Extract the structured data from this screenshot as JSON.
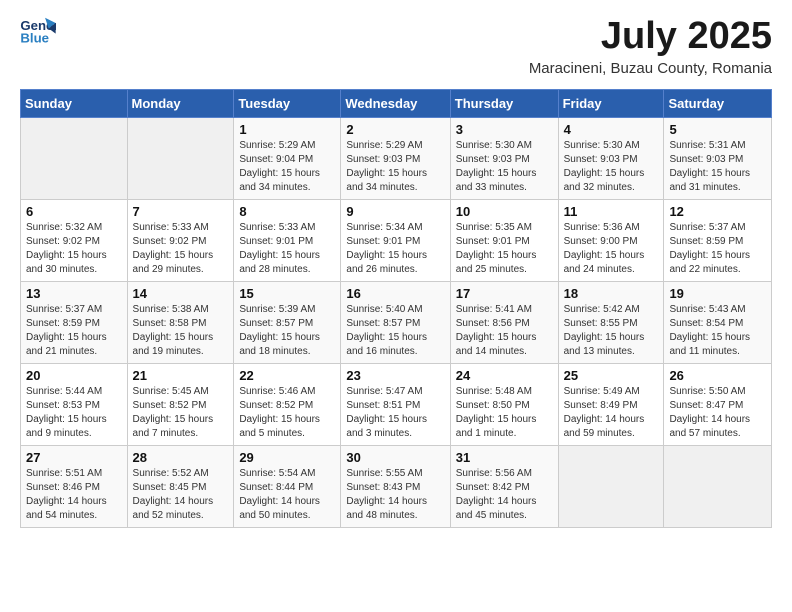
{
  "logo": {
    "line1": "General",
    "line2": "Blue"
  },
  "title": "July 2025",
  "location": "Maracineni, Buzau County, Romania",
  "weekdays": [
    "Sunday",
    "Monday",
    "Tuesday",
    "Wednesday",
    "Thursday",
    "Friday",
    "Saturday"
  ],
  "weeks": [
    [
      {
        "day": "",
        "detail": ""
      },
      {
        "day": "",
        "detail": ""
      },
      {
        "day": "1",
        "detail": "Sunrise: 5:29 AM\nSunset: 9:04 PM\nDaylight: 15 hours and 34 minutes."
      },
      {
        "day": "2",
        "detail": "Sunrise: 5:29 AM\nSunset: 9:03 PM\nDaylight: 15 hours and 34 minutes."
      },
      {
        "day": "3",
        "detail": "Sunrise: 5:30 AM\nSunset: 9:03 PM\nDaylight: 15 hours and 33 minutes."
      },
      {
        "day": "4",
        "detail": "Sunrise: 5:30 AM\nSunset: 9:03 PM\nDaylight: 15 hours and 32 minutes."
      },
      {
        "day": "5",
        "detail": "Sunrise: 5:31 AM\nSunset: 9:03 PM\nDaylight: 15 hours and 31 minutes."
      }
    ],
    [
      {
        "day": "6",
        "detail": "Sunrise: 5:32 AM\nSunset: 9:02 PM\nDaylight: 15 hours and 30 minutes."
      },
      {
        "day": "7",
        "detail": "Sunrise: 5:33 AM\nSunset: 9:02 PM\nDaylight: 15 hours and 29 minutes."
      },
      {
        "day": "8",
        "detail": "Sunrise: 5:33 AM\nSunset: 9:01 PM\nDaylight: 15 hours and 28 minutes."
      },
      {
        "day": "9",
        "detail": "Sunrise: 5:34 AM\nSunset: 9:01 PM\nDaylight: 15 hours and 26 minutes."
      },
      {
        "day": "10",
        "detail": "Sunrise: 5:35 AM\nSunset: 9:01 PM\nDaylight: 15 hours and 25 minutes."
      },
      {
        "day": "11",
        "detail": "Sunrise: 5:36 AM\nSunset: 9:00 PM\nDaylight: 15 hours and 24 minutes."
      },
      {
        "day": "12",
        "detail": "Sunrise: 5:37 AM\nSunset: 8:59 PM\nDaylight: 15 hours and 22 minutes."
      }
    ],
    [
      {
        "day": "13",
        "detail": "Sunrise: 5:37 AM\nSunset: 8:59 PM\nDaylight: 15 hours and 21 minutes."
      },
      {
        "day": "14",
        "detail": "Sunrise: 5:38 AM\nSunset: 8:58 PM\nDaylight: 15 hours and 19 minutes."
      },
      {
        "day": "15",
        "detail": "Sunrise: 5:39 AM\nSunset: 8:57 PM\nDaylight: 15 hours and 18 minutes."
      },
      {
        "day": "16",
        "detail": "Sunrise: 5:40 AM\nSunset: 8:57 PM\nDaylight: 15 hours and 16 minutes."
      },
      {
        "day": "17",
        "detail": "Sunrise: 5:41 AM\nSunset: 8:56 PM\nDaylight: 15 hours and 14 minutes."
      },
      {
        "day": "18",
        "detail": "Sunrise: 5:42 AM\nSunset: 8:55 PM\nDaylight: 15 hours and 13 minutes."
      },
      {
        "day": "19",
        "detail": "Sunrise: 5:43 AM\nSunset: 8:54 PM\nDaylight: 15 hours and 11 minutes."
      }
    ],
    [
      {
        "day": "20",
        "detail": "Sunrise: 5:44 AM\nSunset: 8:53 PM\nDaylight: 15 hours and 9 minutes."
      },
      {
        "day": "21",
        "detail": "Sunrise: 5:45 AM\nSunset: 8:52 PM\nDaylight: 15 hours and 7 minutes."
      },
      {
        "day": "22",
        "detail": "Sunrise: 5:46 AM\nSunset: 8:52 PM\nDaylight: 15 hours and 5 minutes."
      },
      {
        "day": "23",
        "detail": "Sunrise: 5:47 AM\nSunset: 8:51 PM\nDaylight: 15 hours and 3 minutes."
      },
      {
        "day": "24",
        "detail": "Sunrise: 5:48 AM\nSunset: 8:50 PM\nDaylight: 15 hours and 1 minute."
      },
      {
        "day": "25",
        "detail": "Sunrise: 5:49 AM\nSunset: 8:49 PM\nDaylight: 14 hours and 59 minutes."
      },
      {
        "day": "26",
        "detail": "Sunrise: 5:50 AM\nSunset: 8:47 PM\nDaylight: 14 hours and 57 minutes."
      }
    ],
    [
      {
        "day": "27",
        "detail": "Sunrise: 5:51 AM\nSunset: 8:46 PM\nDaylight: 14 hours and 54 minutes."
      },
      {
        "day": "28",
        "detail": "Sunrise: 5:52 AM\nSunset: 8:45 PM\nDaylight: 14 hours and 52 minutes."
      },
      {
        "day": "29",
        "detail": "Sunrise: 5:54 AM\nSunset: 8:44 PM\nDaylight: 14 hours and 50 minutes."
      },
      {
        "day": "30",
        "detail": "Sunrise: 5:55 AM\nSunset: 8:43 PM\nDaylight: 14 hours and 48 minutes."
      },
      {
        "day": "31",
        "detail": "Sunrise: 5:56 AM\nSunset: 8:42 PM\nDaylight: 14 hours and 45 minutes."
      },
      {
        "day": "",
        "detail": ""
      },
      {
        "day": "",
        "detail": ""
      }
    ]
  ]
}
